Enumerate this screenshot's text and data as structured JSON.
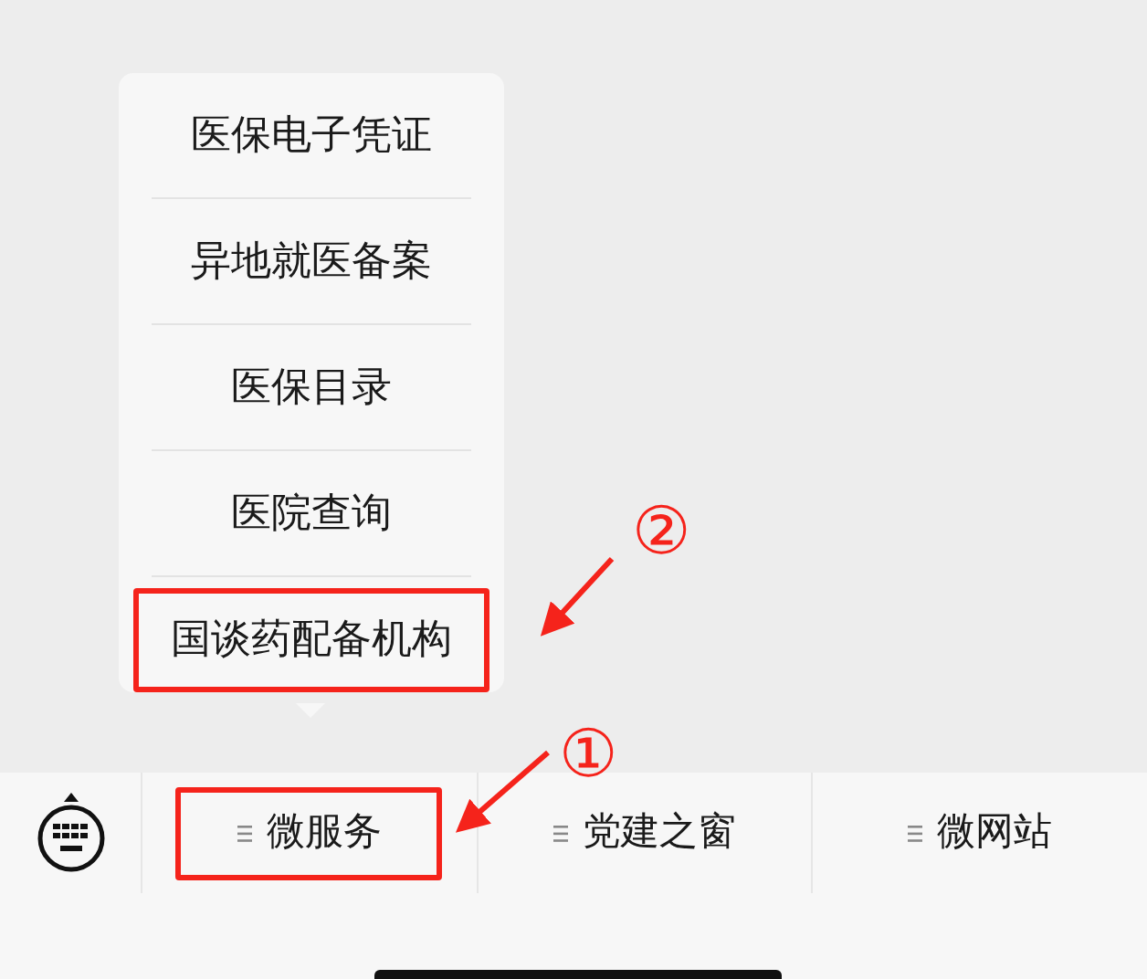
{
  "menu_bar": {
    "tabs": [
      {
        "label": "微服务",
        "highlighted": true,
        "submenu": [
          {
            "label": "医保电子凭证",
            "highlighted": false
          },
          {
            "label": "异地就医备案",
            "highlighted": false
          },
          {
            "label": "医保目录",
            "highlighted": false
          },
          {
            "label": "医院查询",
            "highlighted": false
          },
          {
            "label": "国谈药配备机构",
            "highlighted": true
          }
        ]
      },
      {
        "label": "党建之窗",
        "highlighted": false
      },
      {
        "label": "微网站",
        "highlighted": false
      }
    ]
  },
  "annotations": [
    {
      "label": "②"
    },
    {
      "label": "①"
    }
  ]
}
